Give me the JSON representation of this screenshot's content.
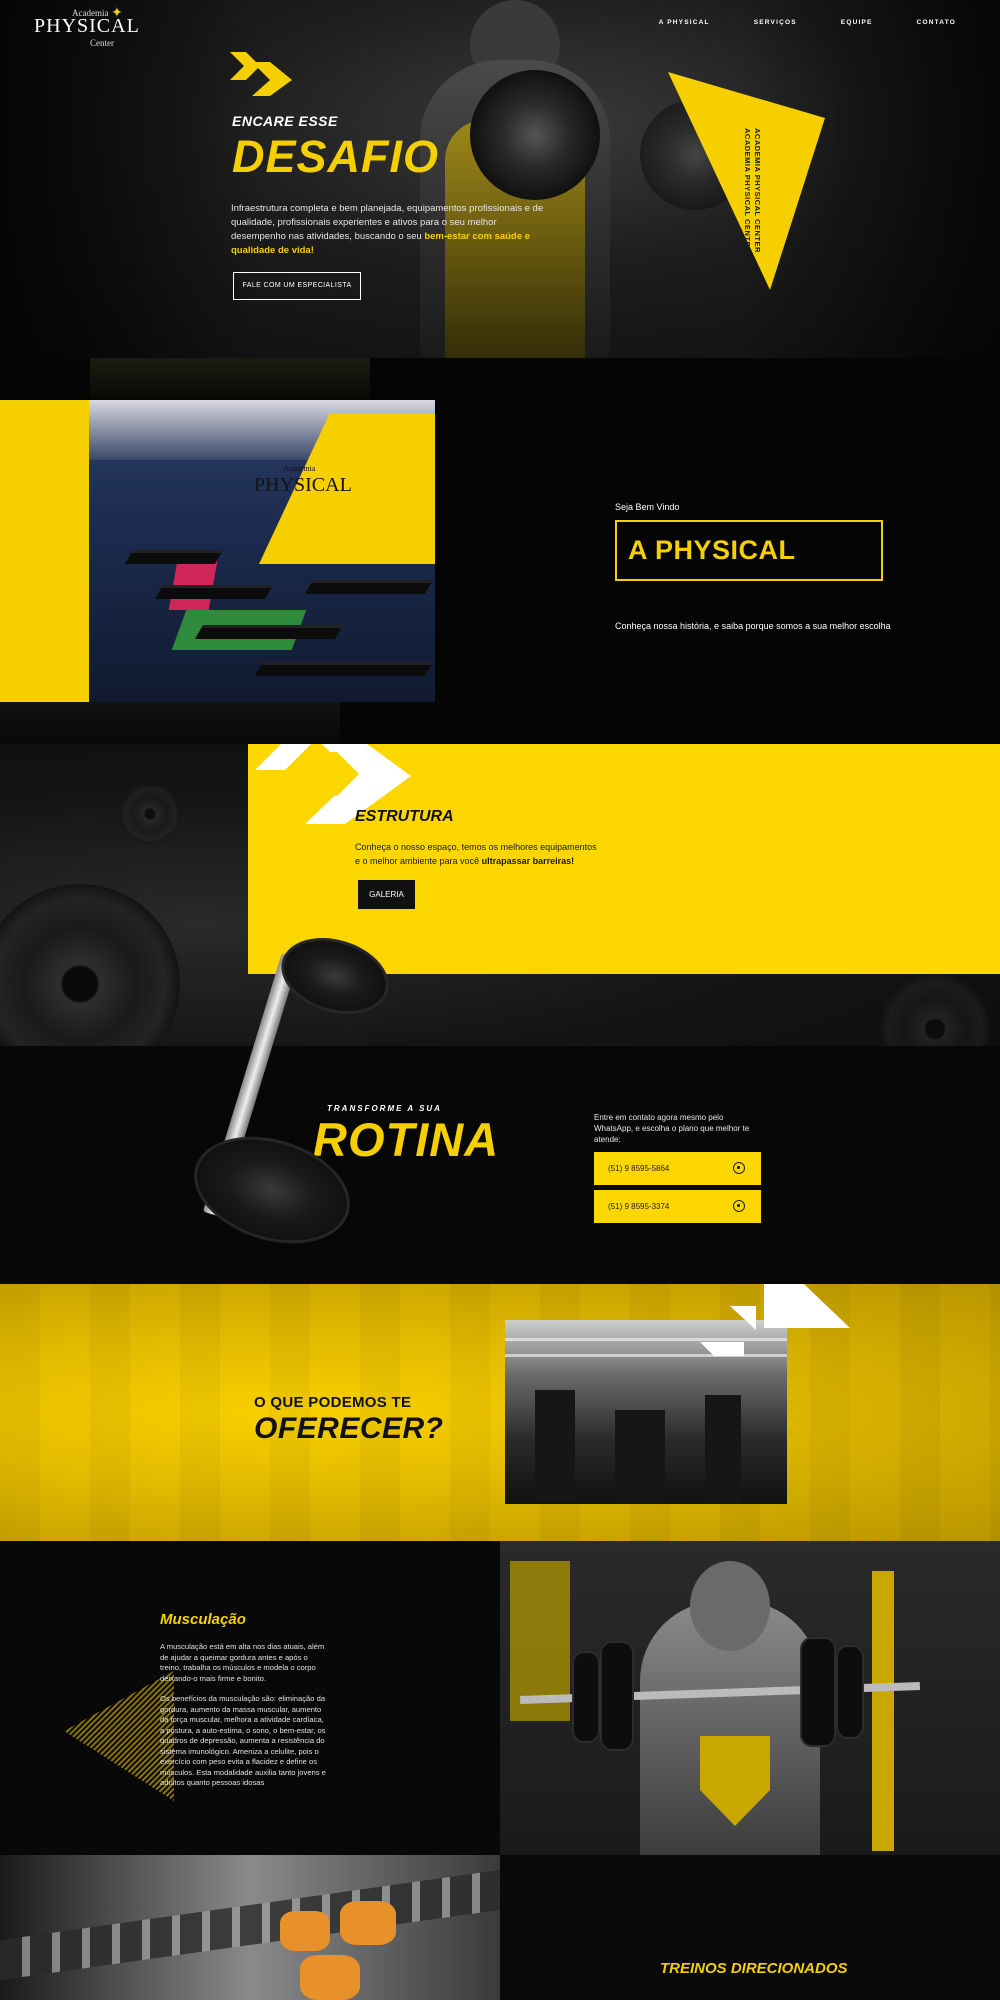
{
  "colors": {
    "accent": "#f5cf00",
    "dark": "#0b0b0b",
    "white": "#ffffff"
  },
  "header": {
    "logo": {
      "line1": "Academia",
      "line2": "PHYSICAL",
      "line3": "Center"
    },
    "nav": [
      "A PHYSICAL",
      "SERVIÇOS",
      "EQUIPE",
      "CONTATO"
    ]
  },
  "hero": {
    "subtitle": "ENCARE ESSE",
    "title": "DESAFIO",
    "text": "Infraestrutura completa e bem planejada, equipamentos profissionais e de qualidade, profissionais experientes e ativos para o seu melhor desempenho nas atividades, buscando o seu ",
    "text_highlight": "bem-estar com saúde e qualidade de vida!",
    "cta": "FALE COM UM ESPECIALISTA",
    "triangle_text_1": "ACADEMIA PHYSICAL CENTER",
    "triangle_text_2": "ACADEMIA PHYSICAL CENTER"
  },
  "about": {
    "kicker": "Seja Bem Vindo",
    "title": "A PHYSICAL",
    "desc": "Conheça nossa história, e saiba porque somos a sua melhor escolha",
    "photo_logo_small": "Academia",
    "photo_logo": "PHYSICAL"
  },
  "estrutura": {
    "title": "ESTRUTURA",
    "text": "Conheça o nosso espaço, temos os melhores equipamentos e o melhor ambiente para você ",
    "text_bold": "ultrapassar barreiras!",
    "button": "GALERIA"
  },
  "rotina": {
    "kicker": "TRANSFORME A SUA",
    "title": "ROTINA",
    "text": "Entre em contato agora mesmo pelo WhatsApp, e escolha o plano que melhor te atende:",
    "phones": [
      "(51) 9 8595-5864",
      "(51) 9 8595-3374"
    ],
    "phone_icon": "whatsapp-icon"
  },
  "oferecer": {
    "kicker": "O QUE PODEMOS TE",
    "title": "OFERECER?"
  },
  "musculacao": {
    "title": "Musculação",
    "p1": "A musculação está em alta nos dias atuais, além de ajudar a queimar gordura antes e após o treino, trabalha os músculos e modela o corpo deixando-o mais firme e bonito.",
    "p2": "Os benefícios da musculação são: eliminação da gordura, aumento da massa muscular, aumento da força muscular, melhora a atividade cardíaca, a postura, a auto-estima, o sono, o bem-estar, os quadros de depressão, aumenta a resistência do sistema imunológico. Ameniza a celulite, pois o exercício com peso evita a flacidez e define os músculos. Esta modalidade auxilia tanto jovens e adultos quanto pessoas idosas"
  },
  "treinos": {
    "title": "TREINOS DIRECIONADOS"
  }
}
